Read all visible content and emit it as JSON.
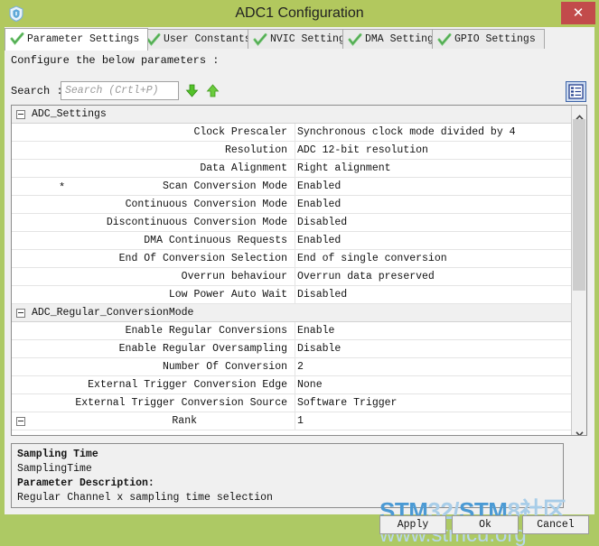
{
  "window": {
    "title": "ADC1 Configuration",
    "icon": "shield-icon",
    "close_label": "✕",
    "frame_color": "#adc964",
    "titlebar_color": "#b2c85e",
    "close_color": "#c24b4b"
  },
  "tabs": [
    {
      "label": "Parameter Settings",
      "active": true,
      "icon": "check-icon"
    },
    {
      "label": "User Constants",
      "active": false,
      "icon": "check-icon"
    },
    {
      "label": "NVIC Settings",
      "active": false,
      "icon": "check-icon"
    },
    {
      "label": "DMA Settings",
      "active": false,
      "icon": "check-icon"
    },
    {
      "label": "GPIO Settings",
      "active": false,
      "icon": "check-icon"
    }
  ],
  "content": {
    "configure_label": "Configure the below parameters :",
    "search_label": "Search :",
    "search_value": "",
    "search_placeholder": "Search (Crtl+P)",
    "search_down_icon": "arrow-down-icon",
    "search_up_icon": "arrow-up-icon",
    "list_toggle_icon": "list-view-icon"
  },
  "tree": {
    "groups": [
      {
        "name": "ADC_Settings",
        "expanded": true,
        "rows": [
          {
            "star": "",
            "name": "Clock Prescaler",
            "value": "Synchronous clock mode divided by 4"
          },
          {
            "star": "",
            "name": "Resolution",
            "value": "ADC 12-bit resolution"
          },
          {
            "star": "",
            "name": "Data Alignment",
            "value": "Right alignment"
          },
          {
            "star": "*",
            "name": "Scan Conversion Mode",
            "value": "Enabled"
          },
          {
            "star": "",
            "name": "Continuous Conversion Mode",
            "value": "Enabled"
          },
          {
            "star": "",
            "name": "Discontinuous Conversion Mode",
            "value": "Disabled"
          },
          {
            "star": "",
            "name": "DMA Continuous Requests",
            "value": "Enabled"
          },
          {
            "star": "",
            "name": "End Of Conversion Selection",
            "value": "End of single conversion"
          },
          {
            "star": "",
            "name": "Overrun behaviour",
            "value": "Overrun data preserved"
          },
          {
            "star": "",
            "name": "Low Power Auto Wait",
            "value": "Disabled"
          }
        ]
      },
      {
        "name": "ADC_Regular_ConversionMode",
        "expanded": true,
        "rows": [
          {
            "star": "",
            "name": "Enable Regular Conversions",
            "value": "Enable"
          },
          {
            "star": "",
            "name": "Enable Regular Oversampling",
            "value": "Disable"
          },
          {
            "star": "",
            "name": "Number Of Conversion",
            "value": "2"
          },
          {
            "star": "",
            "name": "External Trigger Conversion Edge",
            "value": "None"
          },
          {
            "star": "",
            "name": "External Trigger Conversion Source",
            "value": "Software Trigger"
          }
        ]
      }
    ],
    "subnode": {
      "name": "Rank",
      "value": "1",
      "expanded": true
    }
  },
  "description": {
    "title": "Sampling Time",
    "id": "SamplingTime",
    "section_label": "Parameter Description:",
    "text": "Regular Channel x sampling time selection"
  },
  "buttons": {
    "apply": "Apply",
    "ok": "Ok",
    "cancel": "Cancel"
  },
  "watermark": {
    "line1_dark_a": "STM",
    "line1_light_a": "32/",
    "line1_dark_b": "STM",
    "line1_light_b": "8社区",
    "line2": "www.stmcu.org"
  }
}
